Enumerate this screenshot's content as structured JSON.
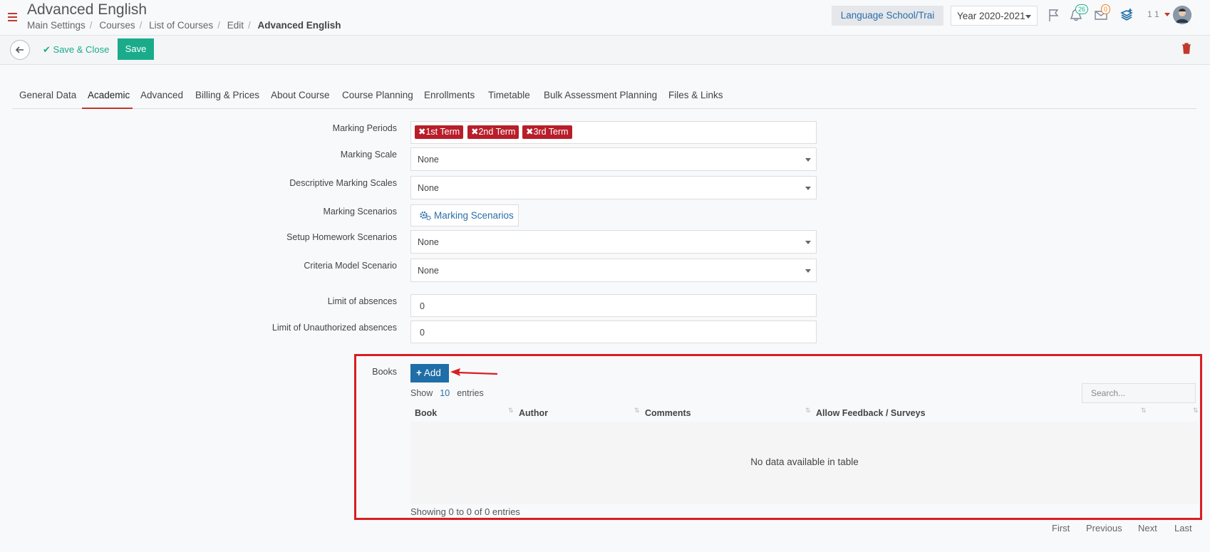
{
  "header": {
    "title": "Advanced English",
    "breadcrumb": [
      "Main Settings",
      "Courses",
      "List of Courses",
      "Edit",
      "Advanced English"
    ],
    "school_button": "Language School/Trai",
    "year_select": "Year 2020-2021",
    "notifications_count": "26",
    "messages_count": "0",
    "user_label": "1 1"
  },
  "toolbar": {
    "save_close_label": "Save & Close",
    "save_label": "Save"
  },
  "tabs": [
    {
      "label": "General Data"
    },
    {
      "label": "Academic"
    },
    {
      "label": "Advanced"
    },
    {
      "label": "Billing & Prices"
    },
    {
      "label": "About Course"
    },
    {
      "label": "Course Planning"
    },
    {
      "label": "Enrollments"
    },
    {
      "label": "Timetable"
    },
    {
      "label": "Bulk Assessment Planning"
    },
    {
      "label": "Files & Links"
    }
  ],
  "form": {
    "marking_periods": {
      "label": "Marking Periods",
      "tags": [
        "1st Term",
        "2nd Term",
        "3rd Term"
      ]
    },
    "marking_scale": {
      "label": "Marking Scale",
      "value": "None"
    },
    "descriptive_marking_scales": {
      "label": "Descriptive Marking Scales",
      "value": "None"
    },
    "marking_scenarios": {
      "label": "Marking Scenarios",
      "button": "Marking Scenarios"
    },
    "setup_homework_scenarios": {
      "label": "Setup Homework Scenarios",
      "value": "None"
    },
    "criteria_model_scenario": {
      "label": "Criteria Model Scenario",
      "value": "None"
    },
    "limit_absences": {
      "label": "Limit of absences",
      "value": "0"
    },
    "limit_unauthorized_absences": {
      "label": "Limit of Unauthorized absences",
      "value": "0"
    }
  },
  "books": {
    "label": "Books",
    "add_button": "Add",
    "show_label": "Show",
    "show_count": "10",
    "entries_label": "entries",
    "search_placeholder": "Search...",
    "columns": [
      "Book",
      "Author",
      "Comments",
      "Allow Feedback / Surveys"
    ],
    "empty_text": "No data available in table",
    "showing_text": "Showing 0 to 0 of 0 entries",
    "pagination": [
      "First",
      "Previous",
      "Next",
      "Last"
    ]
  },
  "colors": {
    "accent_red": "#c0392b",
    "save_green": "#1aab8a",
    "tag_red": "#b81e2a",
    "link_blue": "#2a6ea8",
    "highlight_red": "#d81e24"
  }
}
